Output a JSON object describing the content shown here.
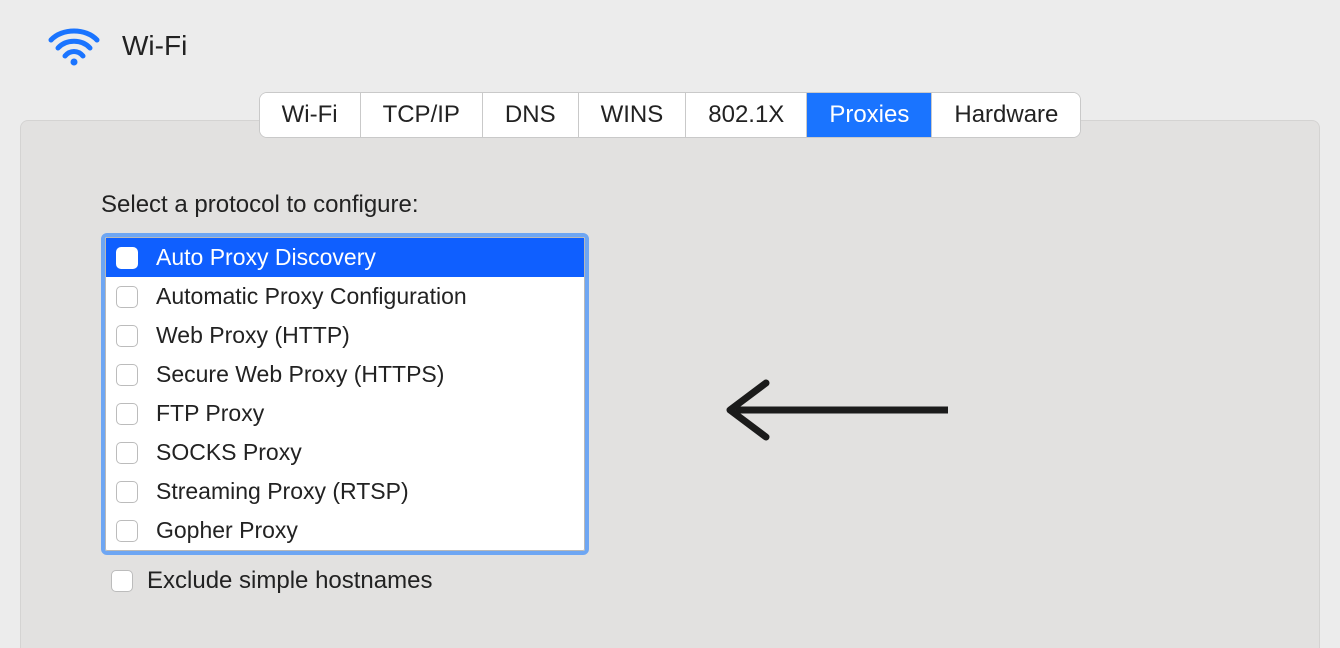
{
  "header": {
    "title": "Wi-Fi"
  },
  "tabs": [
    {
      "label": "Wi-Fi",
      "active": false
    },
    {
      "label": "TCP/IP",
      "active": false
    },
    {
      "label": "DNS",
      "active": false
    },
    {
      "label": "WINS",
      "active": false
    },
    {
      "label": "802.1X",
      "active": false
    },
    {
      "label": "Proxies",
      "active": true
    },
    {
      "label": "Hardware",
      "active": false
    }
  ],
  "protocol_section": {
    "label": "Select a protocol to configure:",
    "items": [
      {
        "label": "Auto Proxy Discovery",
        "checked": false,
        "selected": true
      },
      {
        "label": "Automatic Proxy Configuration",
        "checked": false,
        "selected": false
      },
      {
        "label": "Web Proxy (HTTP)",
        "checked": false,
        "selected": false
      },
      {
        "label": "Secure Web Proxy (HTTPS)",
        "checked": false,
        "selected": false
      },
      {
        "label": "FTP Proxy",
        "checked": false,
        "selected": false
      },
      {
        "label": "SOCKS Proxy",
        "checked": false,
        "selected": false
      },
      {
        "label": "Streaming Proxy (RTSP)",
        "checked": false,
        "selected": false
      },
      {
        "label": "Gopher Proxy",
        "checked": false,
        "selected": false
      }
    ]
  },
  "exclude": {
    "label": "Exclude simple hostnames",
    "checked": false
  }
}
